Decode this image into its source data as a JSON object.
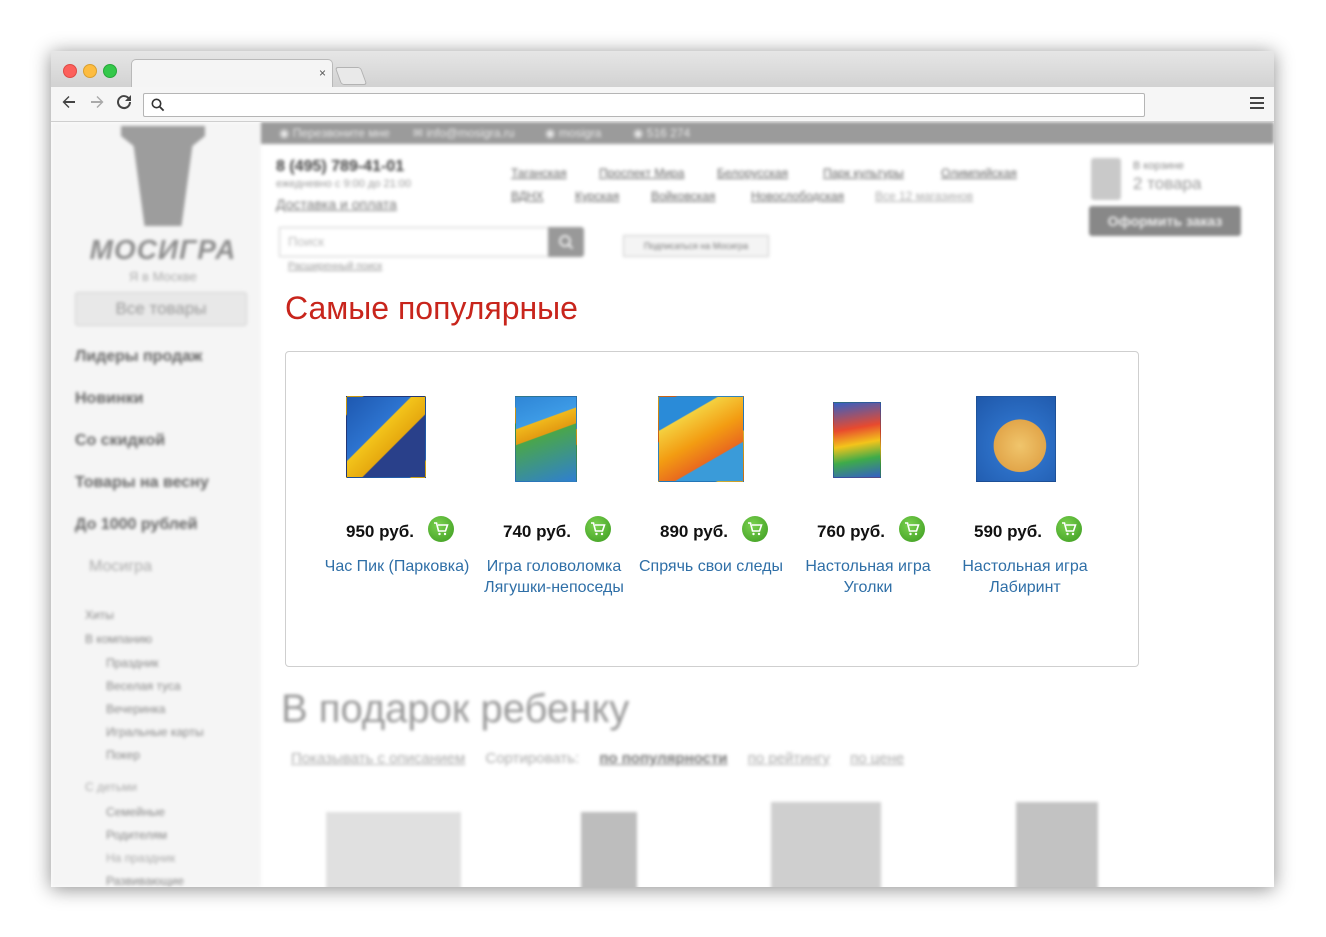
{
  "browser": {
    "tab_close": "×",
    "icons": {
      "back": "arrow-left-icon",
      "forward": "arrow-right-icon",
      "reload": "reload-icon",
      "search": "search-icon",
      "menu": "hamburger-icon"
    }
  },
  "header": {
    "logo_text": "МОСИГРА",
    "city": "Я в Москве",
    "phone": "8 (495) 789-41-01",
    "hours": "ежедневно с 9:00 до 21:00",
    "delivery": "Доставка и оплата",
    "search_placeholder": "Поиск",
    "advanced_search": "Расширенный поиск",
    "subscribe": "Подписаться на Мосигра",
    "metro": [
      "Таганская",
      "Проспект Мира",
      "Белорусская",
      "Парк культуры",
      "Олимпийская",
      "ВДНХ",
      "Курская",
      "Войковская",
      "Новослободская"
    ],
    "all_stores": "Все 12 магазинов",
    "cart_label": "В корзине",
    "cart_count": "2 товара",
    "order_button": "Оформить заказ"
  },
  "sidebar": {
    "all_goods": "Все товары",
    "items": [
      "Лидеры продаж",
      "Новинки",
      "Со скидкой",
      "Товары на весну",
      "До 1000 рублей"
    ],
    "section": "Мосигра",
    "sub": [
      "Хиты",
      "В компанию",
      "Праздник",
      "Веселая туса",
      "Вечеринка",
      "Игральные карты",
      "Покер",
      "С детьми",
      "Семейные",
      "Родителям",
      "На праздник",
      "Развивающие"
    ]
  },
  "popular": {
    "title": "Самые популярные",
    "products": [
      {
        "price": "950 руб.",
        "name": "Час Пик (Парковка)",
        "color": "#2b63b8"
      },
      {
        "price": "740 руб.",
        "name": "Игра головоломка Лягушки-непоседы",
        "color": "#2f7fd1"
      },
      {
        "price": "890 руб.",
        "name": "Спрячь свои следы",
        "color": "#2a8bd8"
      },
      {
        "price": "760 руб.",
        "name": "Настольная игра Уголки",
        "color": "#3560c4"
      },
      {
        "price": "590 руб.",
        "name": "Настольная игра Лабиринт",
        "color": "#2c6fc6"
      }
    ]
  },
  "gift": {
    "title": "В подарок ребенку",
    "show_desc": "Показывать с описанием",
    "sort_label": "Сортировать:",
    "sort_popular": "по популярности",
    "sort_rating": "по рейтингу",
    "sort_price": "по цене"
  }
}
